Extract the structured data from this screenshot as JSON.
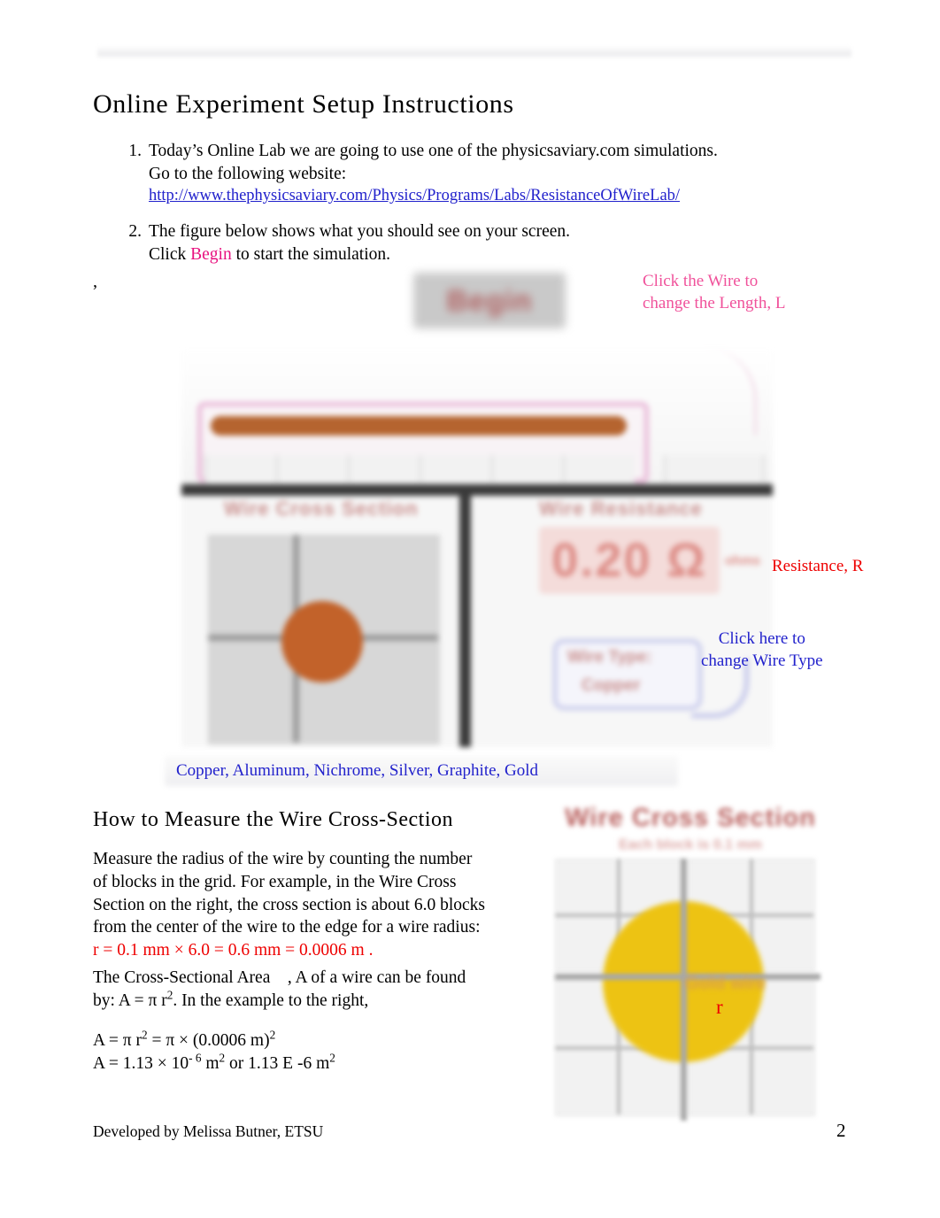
{
  "document": {
    "title": "Online Experiment Setup Instructions",
    "page_number": "2",
    "footer": "Developed by Melissa Butner,    ETSU",
    "stray_mark": ","
  },
  "instructions": [
    {
      "number": "1.",
      "line1": "Today’s Online Lab we are going to use one of the physicsaviary.com simulations.",
      "line2": "Go to the following website:",
      "url": "http://www.thephysicsaviary.com/Physics/Programs/Labs/ResistanceOfWireLab/"
    },
    {
      "number": "2.",
      "line1": "The figure below shows what you should see on your screen.",
      "line2_pre": "Click ",
      "line2_keyword": "Begin",
      "line2_post": "  to start the simulation."
    }
  ],
  "annotations": {
    "length": {
      "line1": "Click the Wire to",
      "line2": "change the Length,     L",
      "color": "#f0529b"
    },
    "resistance": {
      "text": "Resistance,    R",
      "color": "#ee0000"
    },
    "wire_type": {
      "line1": "Click here to",
      "line2": "change Wire Type",
      "color": "#2222cc"
    },
    "materials": {
      "text": "Copper, Aluminum, Nichrome, Silver, Graphite, Gold",
      "color": "#2222cc"
    }
  },
  "simulation": {
    "begin_button_label": "Begin",
    "cross_section_label": "Wire Cross Section",
    "resistance_label": "Wire Resistance",
    "resistance_value": "0.20 Ω",
    "resistance_unit": "ohms",
    "wire_type_label": "Wire Type:",
    "wire_type_value": "Copper"
  },
  "section": {
    "heading": "How to Measure the Wire Cross-Section",
    "paragraph1": {
      "line1": "Measure the radius of the wire by counting the number",
      "line2": "of blocks in the grid. For example, in the Wire Cross",
      "line3": "Section on the right, the cross section is about 6.0 blocks",
      "line4": "from the center of the wire to the edge for a wire radius:",
      "formula_red": "r = 0.1 mm  ×  6.0 = 0.6 mm = 0.0006 m .",
      "formula_color": "#ee0000"
    },
    "paragraph2": {
      "line1_a": "The Cross-Sectional Area",
      "line1_b": ", A of a wire can be found",
      "line2_a": "by: A =  π r",
      "line2_sup": "2",
      "line2_b": ". In the example to the right,"
    },
    "equations": {
      "eq1_a": "A =  π r",
      "eq1_sup1": "2",
      "eq1_b": " =  π ×  (0.0006 m)",
      "eq1_sup2": "2",
      "eq2_a": "A = 1.13  ×  10",
      "eq2_sup1": "- 6",
      "eq2_b": " m",
      "eq2_sup2": "2",
      "eq2_c": " or 1.13 E -6 m",
      "eq2_sup3": "2"
    }
  },
  "cross_section_figure": {
    "title": "Wire Cross Section",
    "subtitle": "Each block is 0.1 mm",
    "watermark": "Gold wire",
    "radius_label": "r",
    "radius_label_color": "#ee0000",
    "wire_color": "#edc313"
  }
}
